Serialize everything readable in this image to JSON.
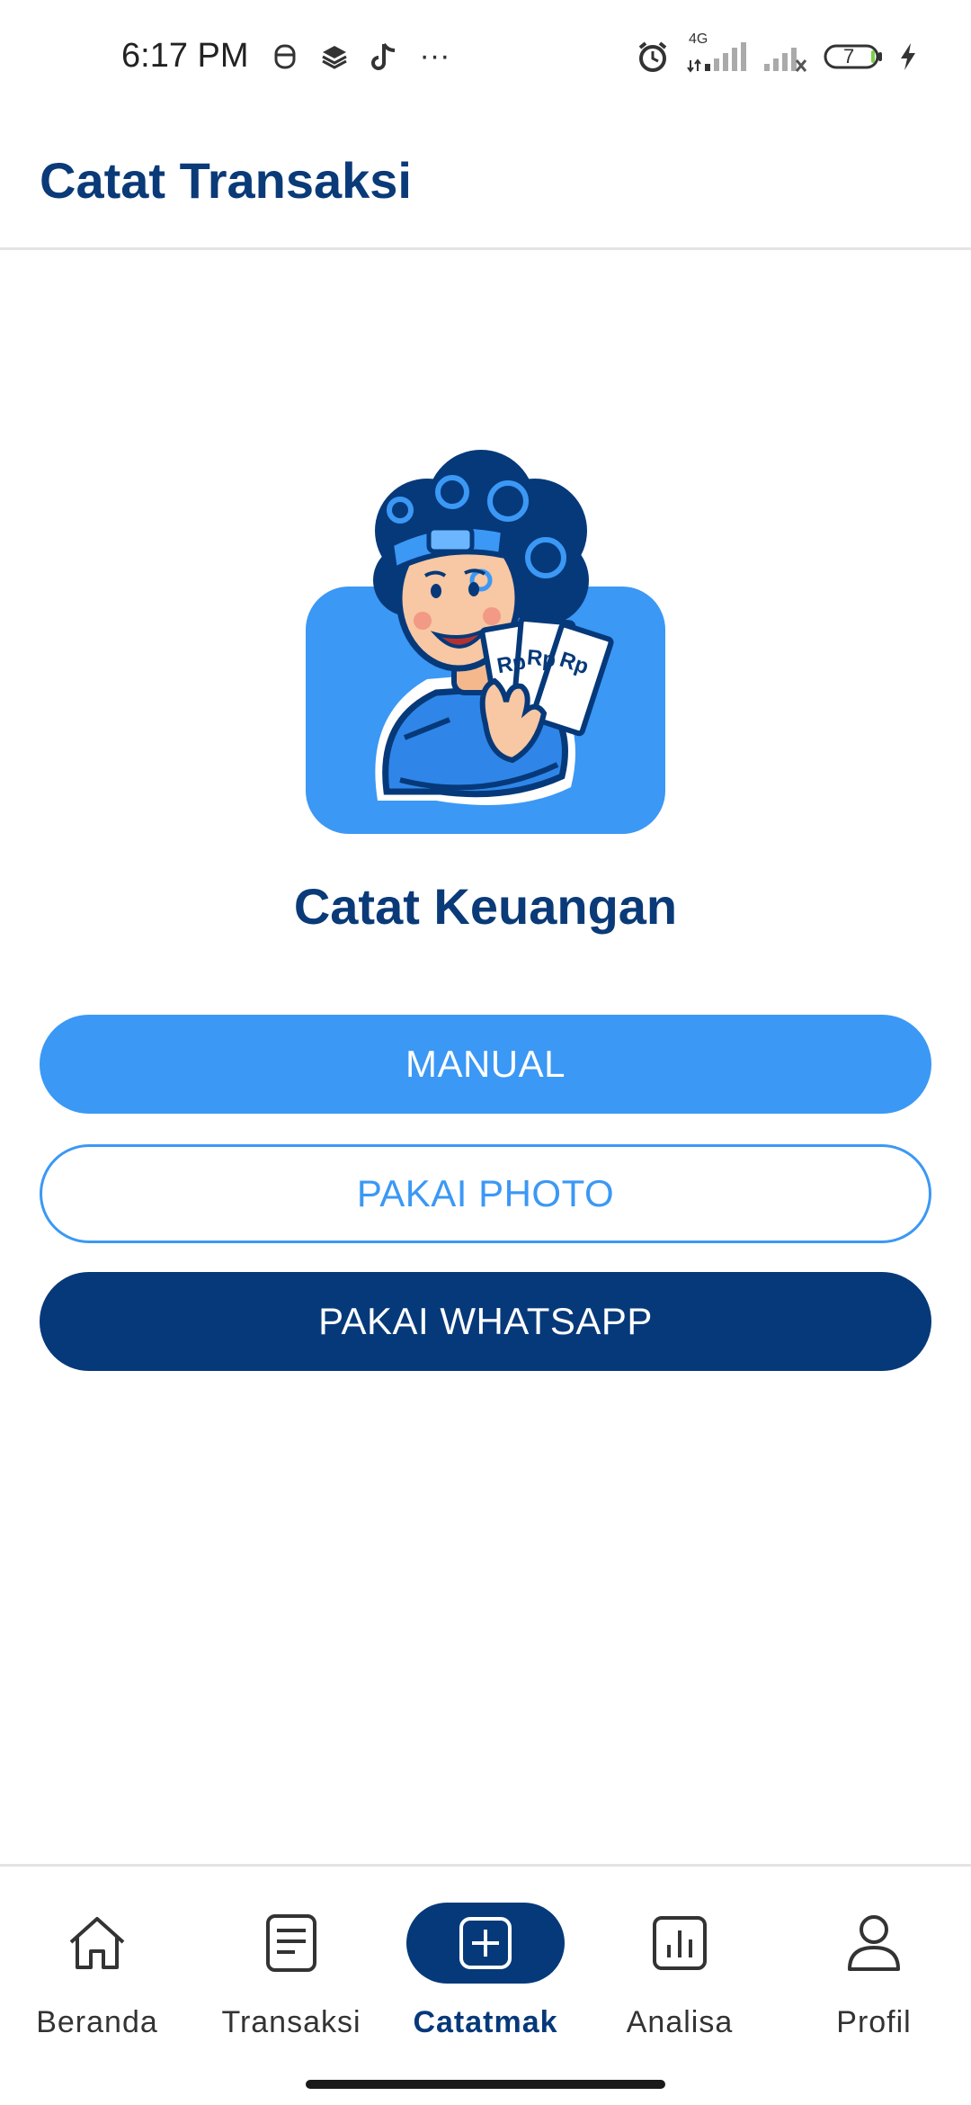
{
  "status_bar": {
    "time": "6:17 PM",
    "more": "···",
    "network": "4G",
    "battery": "7"
  },
  "header": {
    "title": "Catat Transaksi"
  },
  "main": {
    "title": "Catat Keuangan",
    "buttons": {
      "manual": "MANUAL",
      "photo": "PAKAI PHOTO",
      "whatsapp": "PAKAI WHATSAPP"
    },
    "illustration_money_text": [
      "Rp",
      "Rp",
      "Rp"
    ]
  },
  "bottom_nav": {
    "items": [
      {
        "label": "Beranda",
        "icon": "home-icon"
      },
      {
        "label": "Transaksi",
        "icon": "document-icon"
      },
      {
        "label": "Catatmak",
        "icon": "plus-square-icon",
        "active": true
      },
      {
        "label": "Analisa",
        "icon": "bar-chart-icon"
      },
      {
        "label": "Profil",
        "icon": "user-icon"
      }
    ]
  },
  "colors": {
    "primary_dark": "#06397a",
    "primary": "#3b98f5",
    "title": "#0a3a78"
  }
}
